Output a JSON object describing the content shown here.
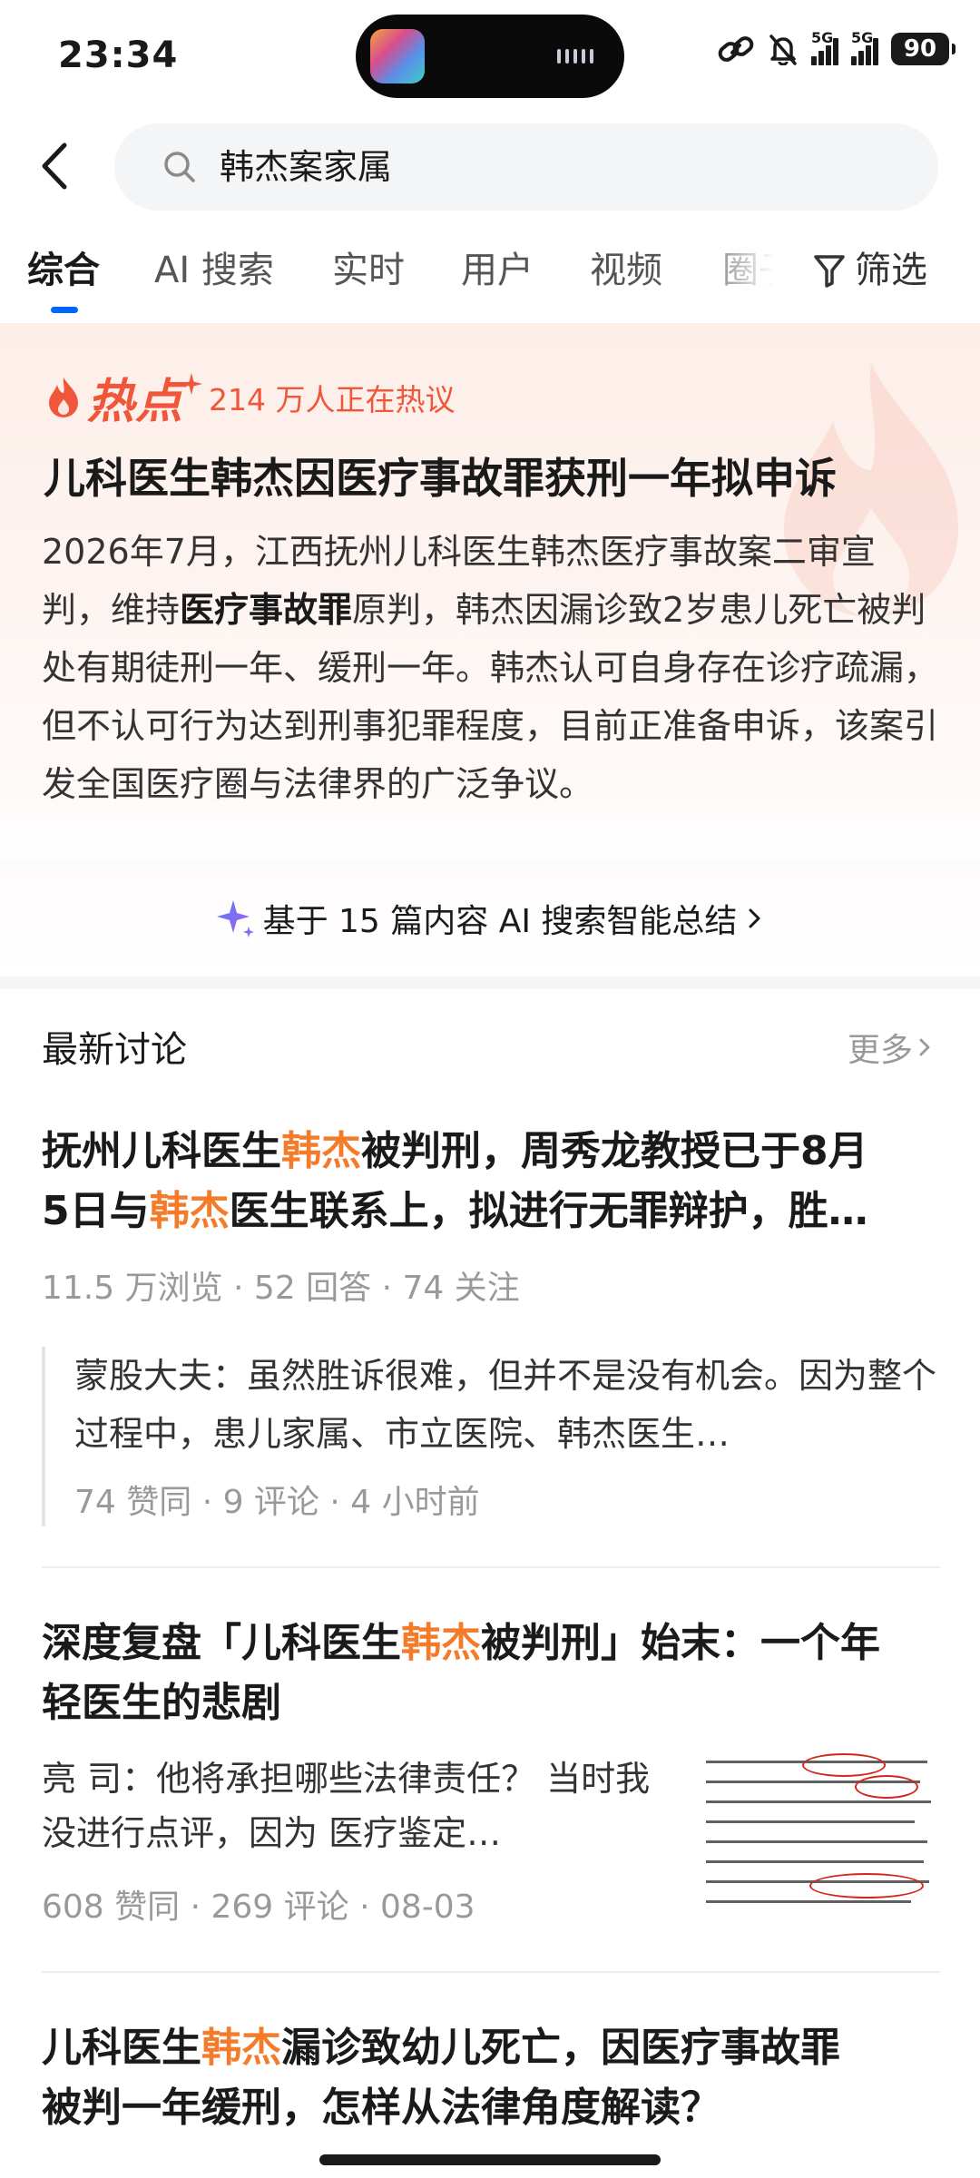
{
  "status": {
    "time": "23:34",
    "net1": "5G",
    "net2": "5G",
    "battery": "90"
  },
  "search": {
    "query": "韩杰案家属"
  },
  "tabs": [
    "综合",
    "AI 搜索",
    "实时",
    "用户",
    "视频",
    "圈子"
  ],
  "filter_label": "筛选",
  "hot": {
    "badge": "热点",
    "count": "214 万人正在热议",
    "title": "儿科医生韩杰因医疗事故罪获刑一年拟申诉",
    "summary_a": "2026年7月，江西抚州儿科医生韩杰医疗事故案二审宣判，维持",
    "summary_bold": "医疗事故罪",
    "summary_b": "原判，韩杰因漏诊致2岁患儿死亡被判处有期徒刑一年、缓刑一年。韩杰认可自身存在诊疗疏漏，但不认可行为达到刑事犯罪程度，目前正准备申诉，该案引发全国医疗圈与法律界的广泛争议。",
    "ai_summary": "基于 15 篇内容 AI 搜索智能总结"
  },
  "latest": {
    "heading": "最新讨论",
    "more": "更多"
  },
  "posts": [
    {
      "t1": "抚州儿科医生",
      "h1": "韩杰",
      "t2": "被判刑，周秀龙教授已于8月",
      "t3": "5日与",
      "h2": "韩杰",
      "t4": "医生联系上，拟进行无罪辩护，胜…",
      "meta": "11.5 万浏览 · 52 回答 · 74 关注",
      "answer": "蒙股大夫：虽然胜诉很难，但并不是没有机会。因为整个过程中，患儿家属、市立医院、韩杰医生…",
      "answer_meta": "74 赞同 · 9 评论 · 4 小时前"
    },
    {
      "t1": "深度复盘「儿科医生",
      "h1": "韩杰",
      "t2": "被判刑」始末：一个年",
      "t3": "轻医生的悲剧",
      "summary": "亮 司：他将承担哪些法律责任？ 当时我没进行点评，因为 医疗鉴定…",
      "meta": "608 赞同 · 269 评论 · 08-03"
    },
    {
      "t1": "儿科医生",
      "h1": "韩杰",
      "t2": "漏诊致幼儿死亡，因医疗事故罪",
      "t3": "被判一年缓刑，怎样从法律角度解读？"
    }
  ],
  "colors": {
    "accent": "#0066ff",
    "hot": "#f0563a",
    "highlight": "#f37b2a"
  }
}
